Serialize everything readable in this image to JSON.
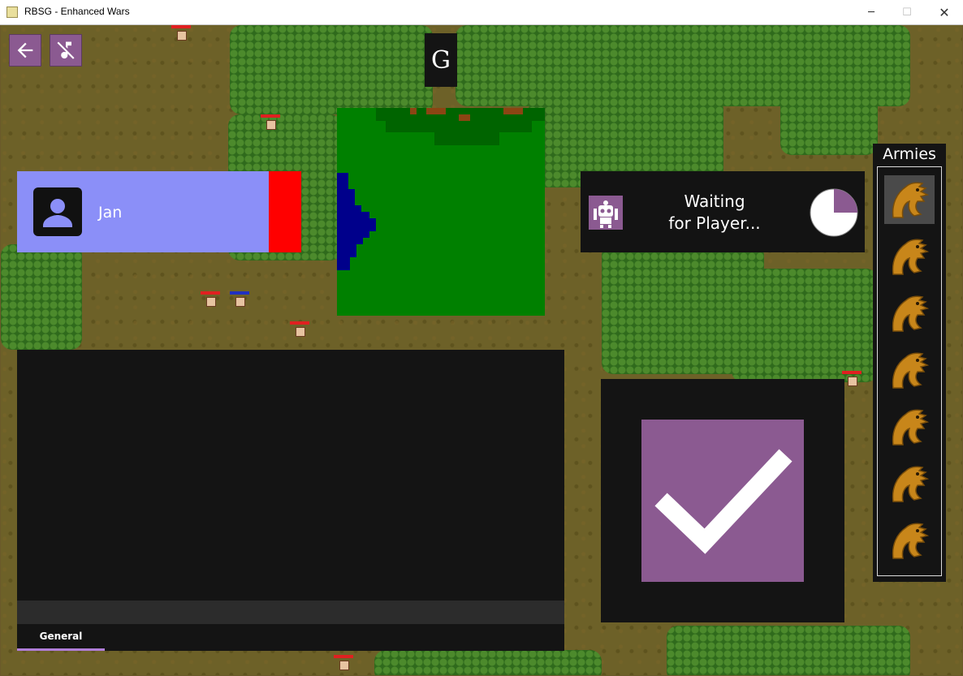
{
  "window": {
    "title": "RBSG - Enhanced Wars",
    "minimize_glyph": "─",
    "maximize_glyph": "☐",
    "close_glyph": "✕"
  },
  "toolbar": {
    "back_icon": "arrow-left-icon",
    "music_icon": "music-off-icon"
  },
  "game_info": {
    "badge": "G"
  },
  "player": {
    "name": "Jan",
    "avatar_icon": "person-icon",
    "color": "#ff0000"
  },
  "status": {
    "bot_icon": "robot-icon",
    "message": "Waiting\nfor Player...",
    "timer_fraction": 0.25
  },
  "chat": {
    "tabs": [
      "General"
    ],
    "active_tab": "General"
  },
  "ready": {
    "icon": "checkmark-icon"
  },
  "armies": {
    "label": "Armies",
    "count": 7,
    "selected_index": 0,
    "item_icon": "dragon-icon"
  },
  "colors": {
    "accent": "#8b5a91",
    "player_card": "#8b8ff8",
    "panel": "#141414",
    "minimap_land": "#008000",
    "minimap_water": "#00008b",
    "tab_underline": "#b07ed8"
  }
}
